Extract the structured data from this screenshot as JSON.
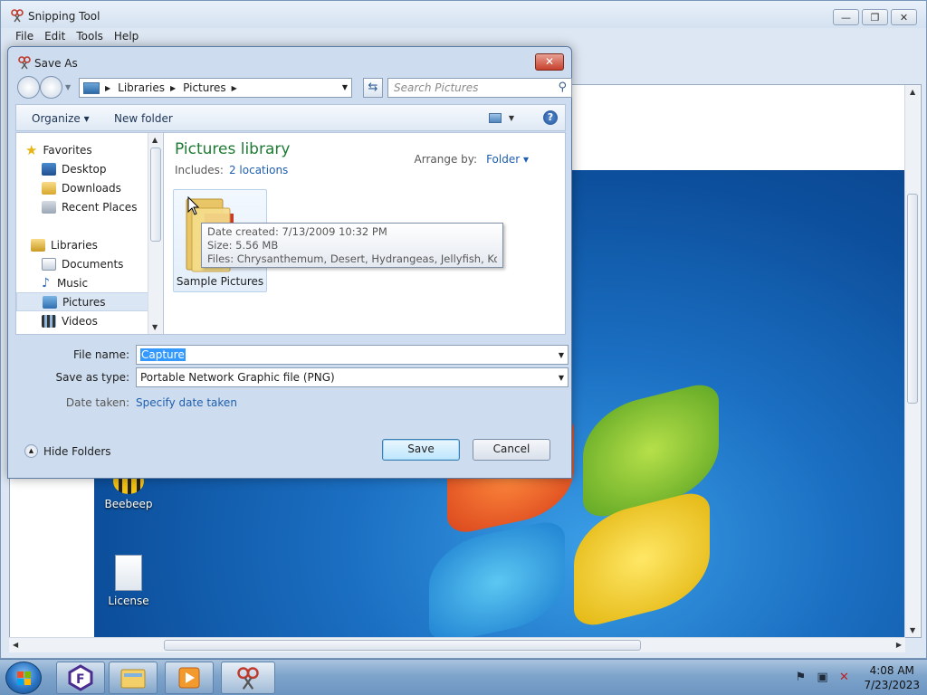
{
  "snipping_tool": {
    "title": "Snipping Tool",
    "menu": [
      "File",
      "Edit",
      "Tools",
      "Help"
    ],
    "window_buttons": {
      "minimize": "—",
      "restore": "❐",
      "close": "✕"
    }
  },
  "desktop_icons": [
    {
      "label": "Beebeep"
    },
    {
      "label": "License"
    }
  ],
  "dialog": {
    "title": "Save As",
    "close": "✕",
    "address": {
      "crumbs": [
        "Libraries",
        "Pictures"
      ]
    },
    "search_placeholder": "Search Pictures",
    "toolbar": {
      "organize": "Organize ▾",
      "new_folder": "New folder",
      "help": "?"
    },
    "nav": {
      "favorites": "Favorites",
      "desktop": "Desktop",
      "downloads": "Downloads",
      "recent": "Recent Places",
      "libraries": "Libraries",
      "documents": "Documents",
      "music": "Music",
      "pictures": "Pictures",
      "videos": "Videos"
    },
    "library": {
      "title": "Pictures library",
      "includes_label": "Includes:",
      "includes_link": "2 locations",
      "arrange_label": "Arrange by:",
      "arrange_value": "Folder ▾"
    },
    "folder": {
      "label": "Sample Pictures"
    },
    "tooltip": {
      "date": "Date created: 7/13/2009 10:32 PM",
      "size": "Size: 5.56 MB",
      "files": "Files: Chrysanthemum, Desert, Hydrangeas, Jellyfish, Koala, ..."
    },
    "file_name": {
      "label": "File name:",
      "value": "Capture"
    },
    "save_type": {
      "label": "Save as type:",
      "value": "Portable Network Graphic file (PNG)"
    },
    "date_taken": {
      "label": "Date taken:",
      "link": "Specify date taken"
    },
    "hide_folders": "Hide Folders",
    "save": "Save",
    "cancel": "Cancel"
  },
  "taskbar": {
    "clock_time": "4:08 AM",
    "clock_date": "7/23/2023"
  },
  "colors": {
    "library_title": "#1e7b34",
    "link": "#1f5fae",
    "selection": "#3399ff"
  }
}
